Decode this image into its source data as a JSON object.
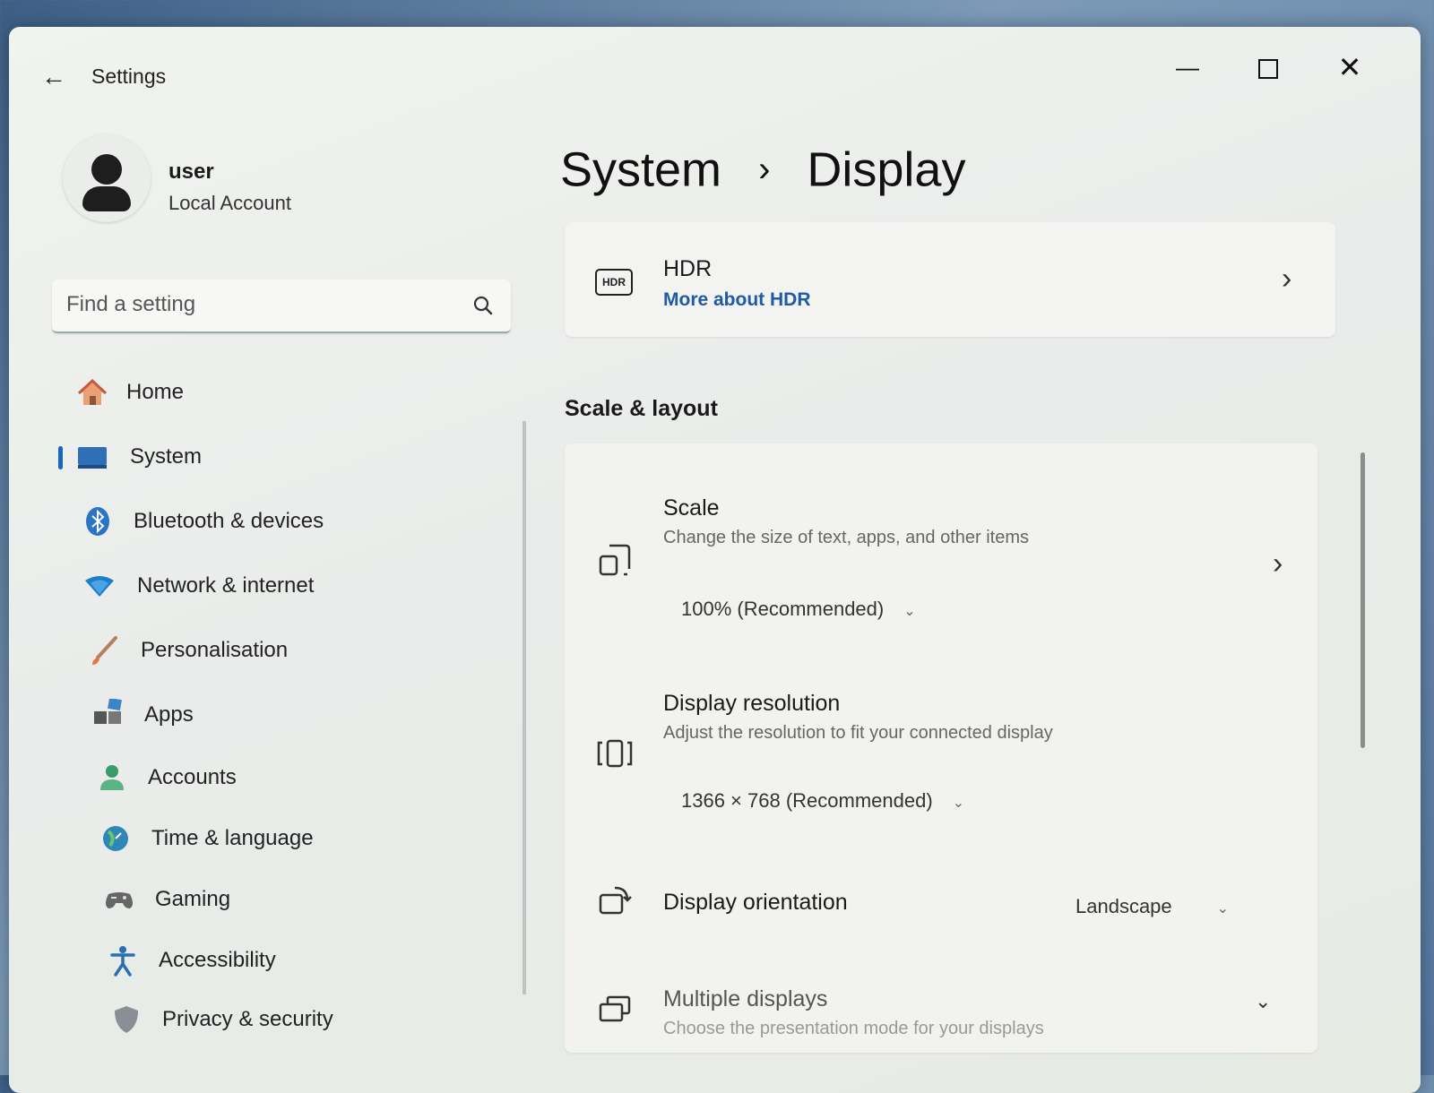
{
  "window": {
    "title": "Settings",
    "back_icon": "arrow-left-icon",
    "controls": [
      "minimize-icon",
      "maximize-icon",
      "close-icon"
    ]
  },
  "profile": {
    "name": "user",
    "account_type": "Local Account"
  },
  "search": {
    "placeholder": "Find a setting"
  },
  "nav": {
    "items": [
      {
        "label": "Home",
        "icon": "home-icon"
      },
      {
        "label": "System",
        "icon": "system-icon",
        "selected": true
      },
      {
        "label": "Bluetooth & devices",
        "icon": "bluetooth-icon"
      },
      {
        "label": "Network & internet",
        "icon": "wifi-icon"
      },
      {
        "label": "Personalisation",
        "icon": "brush-icon"
      },
      {
        "label": "Apps",
        "icon": "apps-icon"
      },
      {
        "label": "Accounts",
        "icon": "accounts-icon"
      },
      {
        "label": "Time & language",
        "icon": "globe-clock-icon"
      },
      {
        "label": "Gaming",
        "icon": "gamepad-icon"
      },
      {
        "label": "Accessibility",
        "icon": "accessibility-icon"
      },
      {
        "label": "Privacy & security",
        "icon": "shield-icon"
      }
    ]
  },
  "breadcrumb": {
    "parent": "System",
    "separator": "›",
    "current": "Display"
  },
  "hdr": {
    "icon_text": "HDR",
    "title": "HDR",
    "link": "More about HDR"
  },
  "scale_layout": {
    "section_title": "Scale & layout",
    "scale": {
      "title": "Scale",
      "subtitle": "Change the size of text, apps, and other items",
      "value": "100% (Recommended)"
    },
    "resolution": {
      "title": "Display resolution",
      "subtitle": "Adjust the resolution to fit your connected display",
      "value": "1366 × 768 (Recommended)"
    },
    "orientation": {
      "title": "Display orientation",
      "value": "Landscape"
    },
    "multiple": {
      "title": "Multiple displays",
      "subtitle": "Choose the presentation mode for your displays"
    }
  },
  "colors": {
    "accent": "#1865c4",
    "link": "#1f5aa6"
  }
}
